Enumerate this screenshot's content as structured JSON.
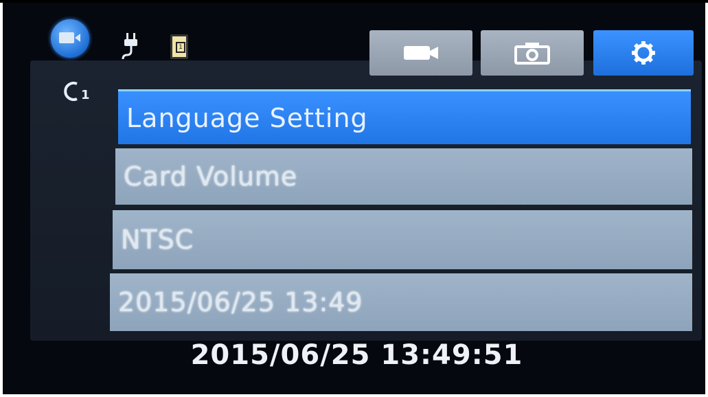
{
  "status_bar": {
    "mode_icon": "video-mode-icon",
    "power_icon": "power-plug-icon",
    "sd_card_icon": "sd-card-icon",
    "sd_card_label": "1"
  },
  "tabs": [
    {
      "icon": "video-camera-icon",
      "active": false
    },
    {
      "icon": "photo-camera-icon",
      "active": false
    },
    {
      "icon": "gear-icon",
      "active": true
    }
  ],
  "loop_indicator": "loop-recording-icon",
  "menu": {
    "items": [
      {
        "label": "Language Setting",
        "selected": true
      },
      {
        "label": "Card Volume",
        "selected": false
      },
      {
        "label": "NTSC",
        "selected": false
      },
      {
        "label": "2015/06/25 13:49",
        "selected": false
      }
    ]
  },
  "clock": "2015/06/25 13:49:51",
  "colors": {
    "selected": "#2a80f0",
    "item": "#97adc3",
    "screen_bg": "#05080f",
    "active_tab": "#2d84f4"
  }
}
